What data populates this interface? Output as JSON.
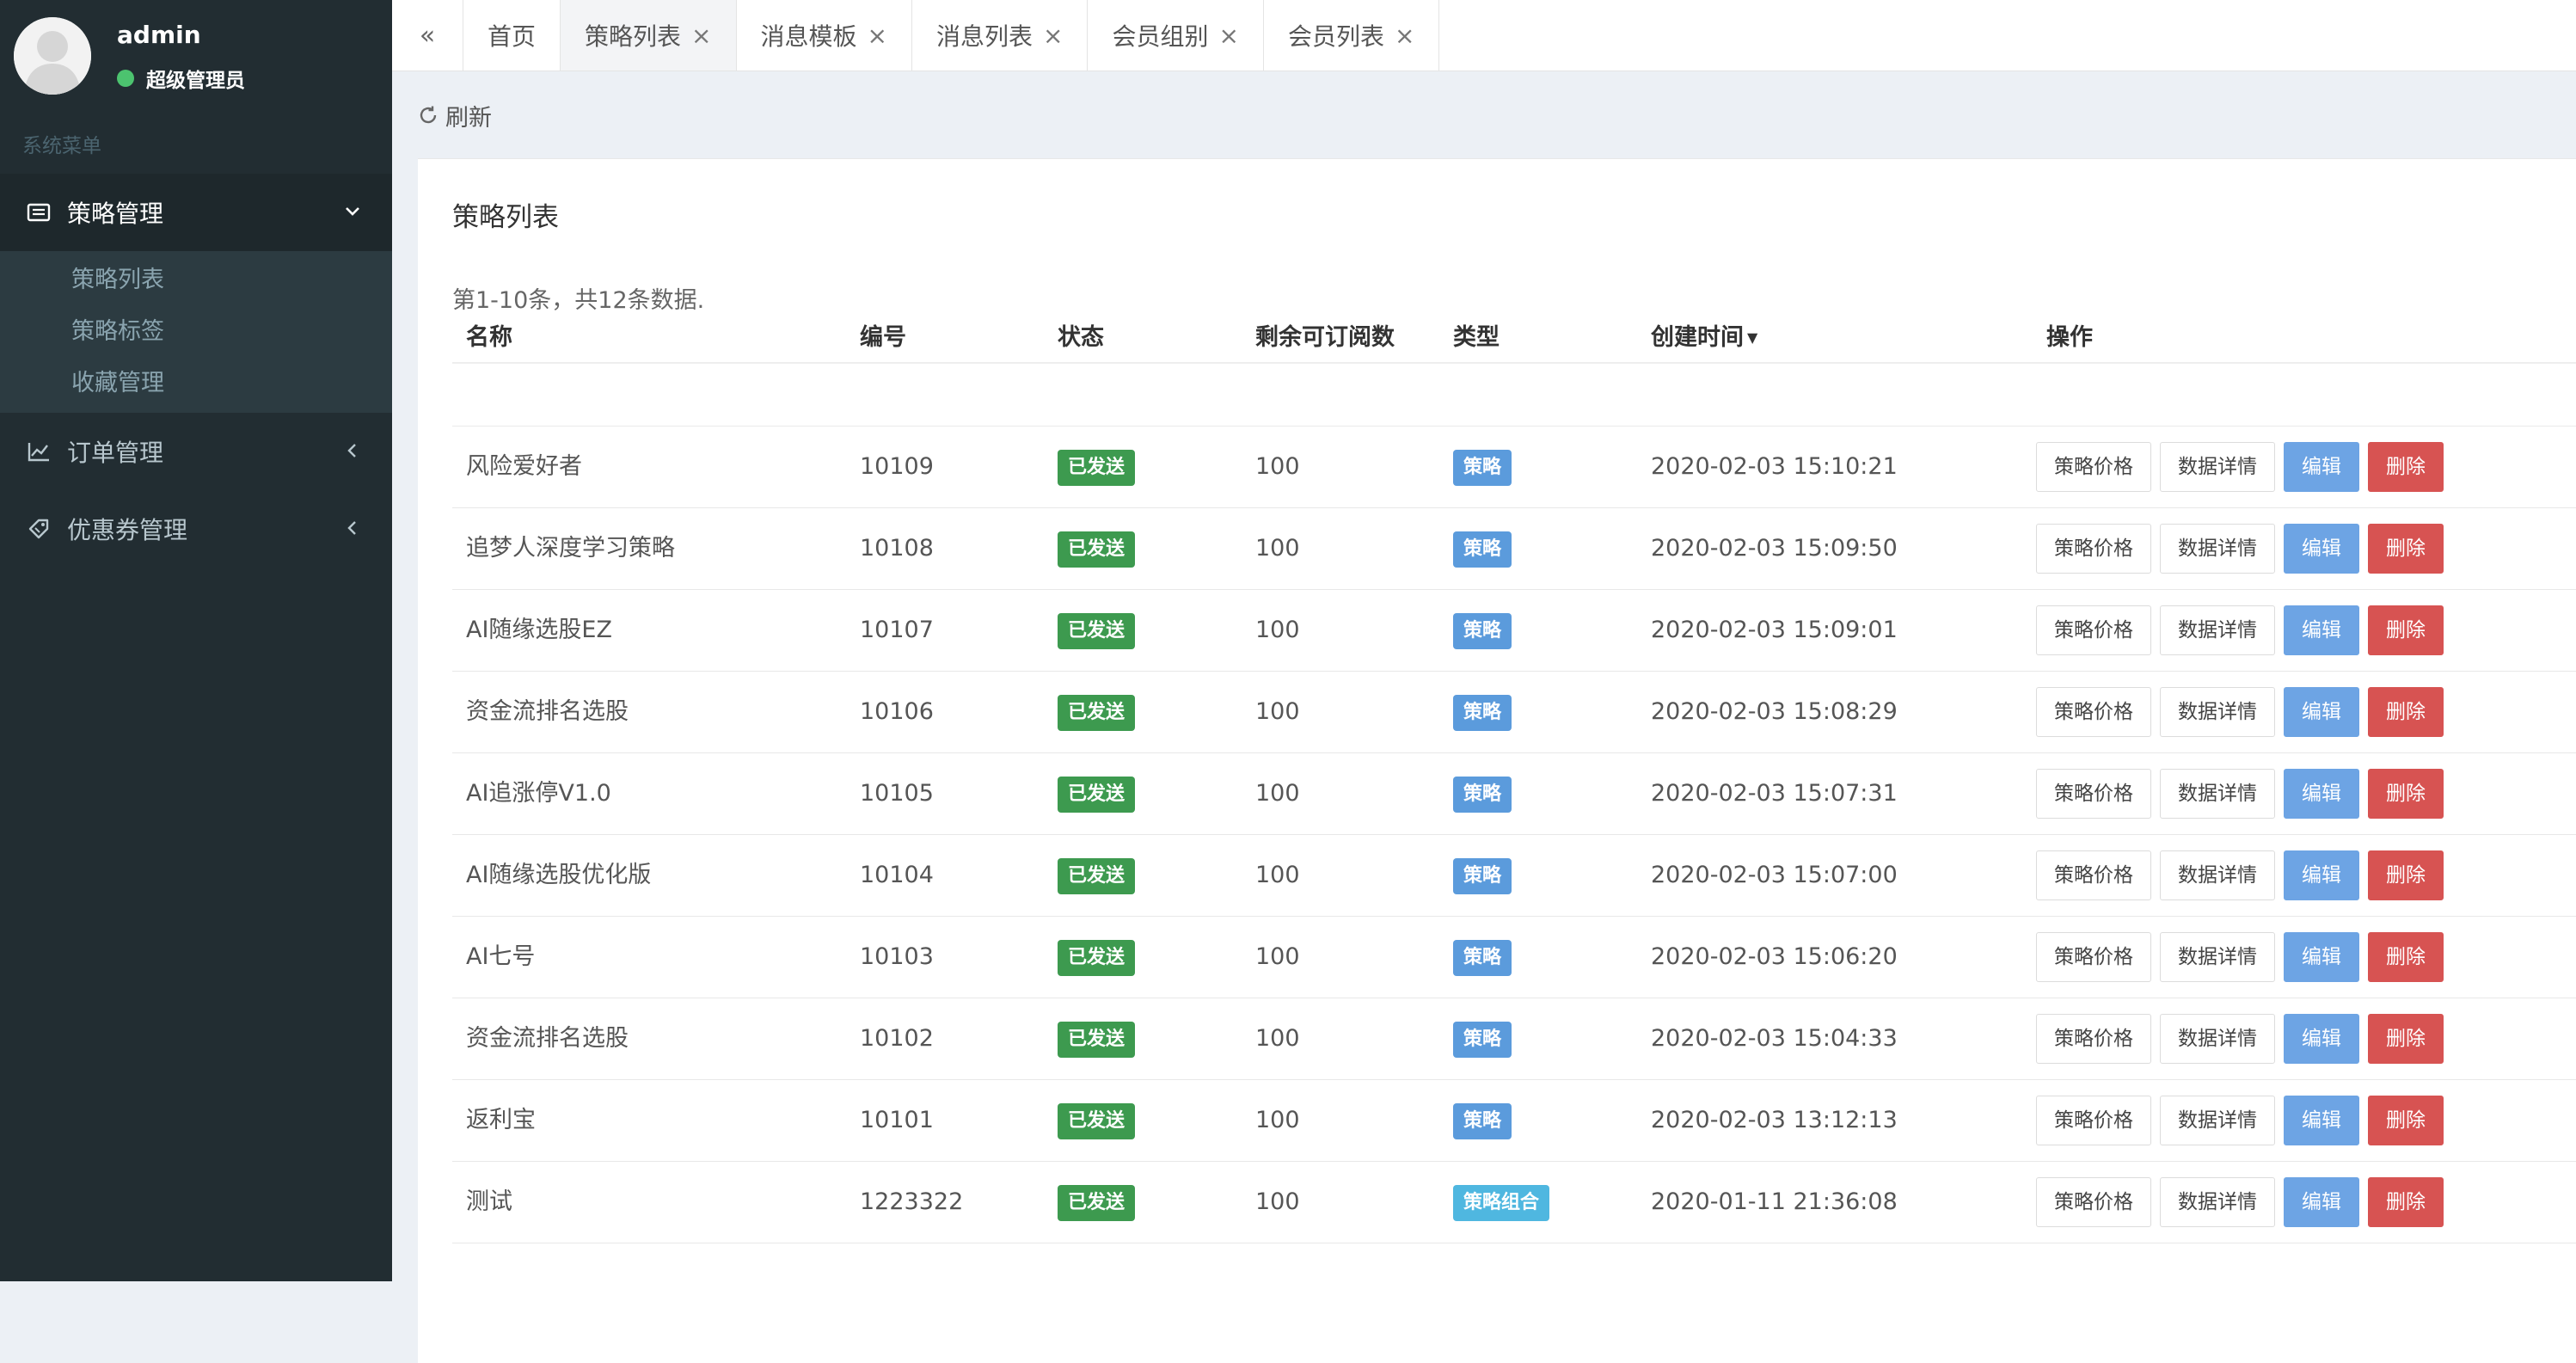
{
  "user": {
    "name": "admin",
    "role": "超级管理员"
  },
  "sidebar": {
    "header": "系统菜单",
    "menu": [
      {
        "label": "策略管理",
        "icon": "list-icon",
        "expanded": true,
        "children": [
          "策略列表",
          "策略标签",
          "收藏管理"
        ]
      },
      {
        "label": "订单管理",
        "icon": "line-chart-icon",
        "expanded": false
      },
      {
        "label": "优惠券管理",
        "icon": "ticket-icon",
        "expanded": false
      }
    ]
  },
  "tabs": [
    {
      "label": "首页",
      "closable": false,
      "active": false
    },
    {
      "label": "策略列表",
      "closable": true,
      "active": true
    },
    {
      "label": "消息模板",
      "closable": true,
      "active": false
    },
    {
      "label": "消息列表",
      "closable": true,
      "active": false
    },
    {
      "label": "会员组别",
      "closable": true,
      "active": false
    },
    {
      "label": "会员列表",
      "closable": true,
      "active": false
    }
  ],
  "tab_collapse": "«",
  "tab_close": "×",
  "toolbar": {
    "refresh_label": "刷新"
  },
  "box": {
    "title": "策略列表",
    "summary": "第1-10条，共12条数据.",
    "columns": [
      "名称",
      "编号",
      "状态",
      "剩余可订阅数",
      "类型",
      "创建时间",
      "操作"
    ],
    "sort_indicator": "▼",
    "actions": {
      "price": "策略价格",
      "detail": "数据详情",
      "edit": "编辑",
      "delete": "删除"
    },
    "rows": [
      {
        "name": "风险爱好者",
        "id": "10109",
        "status": "已发送",
        "remaining": "100",
        "type": "策略",
        "created": "2020-02-03 15:10:21"
      },
      {
        "name": "追梦人深度学习策略",
        "id": "10108",
        "status": "已发送",
        "remaining": "100",
        "type": "策略",
        "created": "2020-02-03 15:09:50"
      },
      {
        "name": "AI随缘选股EZ",
        "id": "10107",
        "status": "已发送",
        "remaining": "100",
        "type": "策略",
        "created": "2020-02-03 15:09:01"
      },
      {
        "name": "资金流排名选股",
        "id": "10106",
        "status": "已发送",
        "remaining": "100",
        "type": "策略",
        "created": "2020-02-03 15:08:29"
      },
      {
        "name": "AI追涨停V1.0",
        "id": "10105",
        "status": "已发送",
        "remaining": "100",
        "type": "策略",
        "created": "2020-02-03 15:07:31"
      },
      {
        "name": "AI随缘选股优化版",
        "id": "10104",
        "status": "已发送",
        "remaining": "100",
        "type": "策略",
        "created": "2020-02-03 15:07:00"
      },
      {
        "name": "AI七号",
        "id": "10103",
        "status": "已发送",
        "remaining": "100",
        "type": "策略",
        "created": "2020-02-03 15:06:20"
      },
      {
        "name": "资金流排名选股",
        "id": "10102",
        "status": "已发送",
        "remaining": "100",
        "type": "策略",
        "created": "2020-02-03 15:04:33"
      },
      {
        "name": "返利宝",
        "id": "10101",
        "status": "已发送",
        "remaining": "100",
        "type": "策略",
        "created": "2020-02-03 13:12:13"
      },
      {
        "name": "测试",
        "id": "1223322",
        "status": "已发送",
        "remaining": "100",
        "type": "策略组合",
        "created": "2020-01-11 21:36:08"
      }
    ]
  },
  "colors": {
    "sidebar_bg": "#222d32",
    "status_green": "#3d9a4f",
    "type_blue": "#5b9bdc",
    "type_cyan": "#4fb7e0",
    "edit_blue": "#6da4e4",
    "delete_red": "#d75352"
  }
}
